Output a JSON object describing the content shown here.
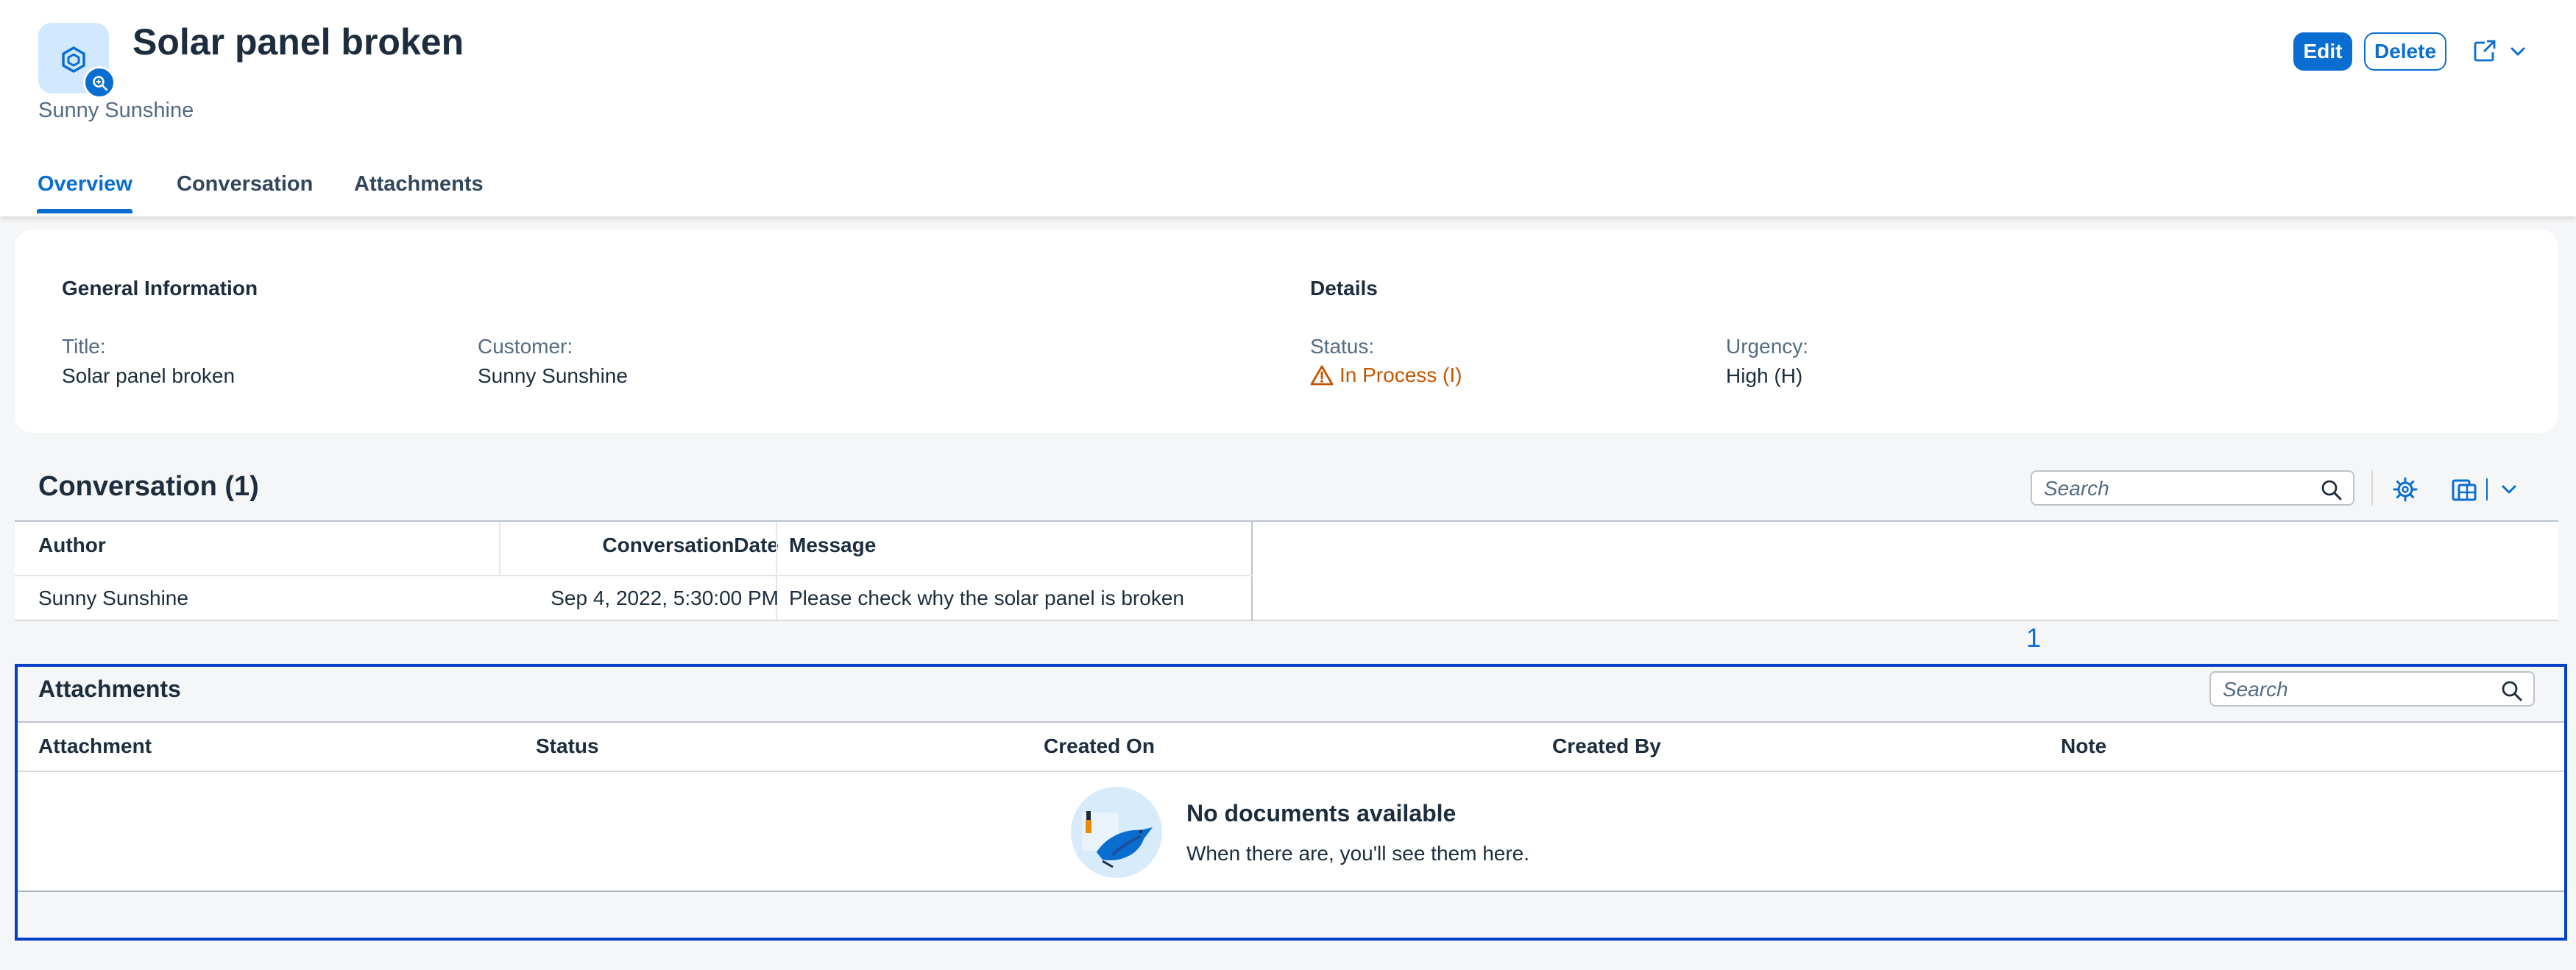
{
  "header": {
    "title": "Solar panel broken",
    "subtitle": "Sunny Sunshine",
    "actions": {
      "edit": "Edit",
      "delete": "Delete"
    }
  },
  "tabs": [
    {
      "label": "Overview",
      "active": true
    },
    {
      "label": "Conversation",
      "active": false
    },
    {
      "label": "Attachments",
      "active": false
    }
  ],
  "general_info": {
    "heading": "General Information",
    "title_label": "Title:",
    "title_value": "Solar panel broken",
    "customer_label": "Customer:",
    "customer_value": "Sunny Sunshine"
  },
  "details": {
    "heading": "Details",
    "status_label": "Status:",
    "status_value": "In Process (I)",
    "status_color": "#c35500",
    "urgency_label": "Urgency:",
    "urgency_value": "High (H)"
  },
  "conversation": {
    "title": "Conversation (1)",
    "search_placeholder": "Search",
    "columns": [
      "Author",
      "ConversationDate",
      "Message"
    ],
    "rows": [
      {
        "author": "Sunny Sunshine",
        "date": "Sep 4, 2022, 5:30:00 PM",
        "message": "Please check why the solar panel is broken"
      }
    ],
    "row_count_marker": "1"
  },
  "attachments": {
    "title": "Attachments",
    "search_placeholder": "Search",
    "columns": [
      "Attachment",
      "Status",
      "Created On",
      "Created By",
      "Note"
    ],
    "empty_title": "No documents available",
    "empty_description": "When there are, you'll see them here."
  },
  "colors": {
    "accent": "#0a6ed1",
    "selection_border": "#0040c8",
    "warning": "#c35500"
  }
}
